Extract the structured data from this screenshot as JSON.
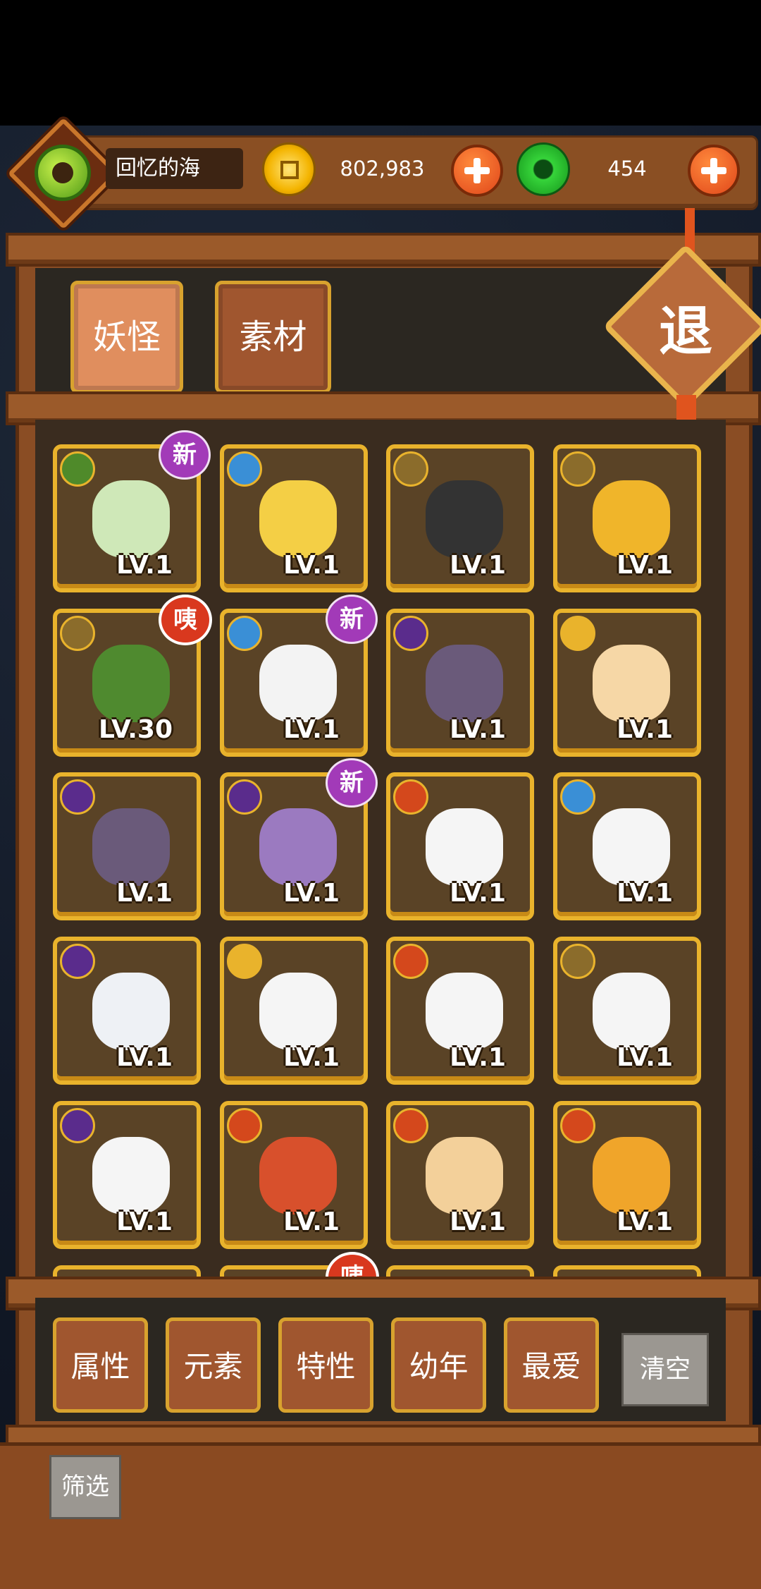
{
  "header": {
    "player_name": "回忆的海",
    "gold": "802,983",
    "jade": "454"
  },
  "tabs": {
    "monsters": "妖怪",
    "materials": "素材"
  },
  "exit_label": "退",
  "cards": [
    {
      "element": "leaf",
      "level": "LV.1",
      "badge": "新",
      "pic_color": "#cfe8b8"
    },
    {
      "element": "water",
      "level": "LV.1",
      "badge": "",
      "pic_color": "#f4cf45"
    },
    {
      "element": "earth",
      "level": "LV.1",
      "badge": "",
      "pic_color": "#333333"
    },
    {
      "element": "earth",
      "level": "LV.1",
      "badge": "",
      "pic_color": "#f0b52a"
    },
    {
      "element": "earth",
      "level": "LV.30",
      "badge": "咦",
      "pic_color": "#4f8a2f"
    },
    {
      "element": "water",
      "level": "LV.1",
      "badge": "新",
      "pic_color": "#f3f3f3"
    },
    {
      "element": "moon",
      "level": "LV.1",
      "badge": "",
      "pic_color": "#6a5a7a"
    },
    {
      "element": "sun",
      "level": "LV.1",
      "badge": "",
      "pic_color": "#f6d7a6"
    },
    {
      "element": "moon",
      "level": "LV.1",
      "badge": "",
      "pic_color": "#6a5a7a"
    },
    {
      "element": "moon",
      "level": "LV.1",
      "badge": "新",
      "pic_color": "#9b7ac0"
    },
    {
      "element": "fire",
      "level": "LV.1",
      "badge": "",
      "pic_color": "#f5f5f5"
    },
    {
      "element": "water",
      "level": "LV.1",
      "badge": "",
      "pic_color": "#f5f5f5"
    },
    {
      "element": "moon",
      "level": "LV.1",
      "badge": "",
      "pic_color": "#eef1f5"
    },
    {
      "element": "sun",
      "level": "LV.1",
      "badge": "",
      "pic_color": "#f5f5f5"
    },
    {
      "element": "fire",
      "level": "LV.1",
      "badge": "",
      "pic_color": "#f5f5f5"
    },
    {
      "element": "earth",
      "level": "LV.1",
      "badge": "",
      "pic_color": "#f5f5f5"
    },
    {
      "element": "moon",
      "level": "LV.1",
      "badge": "",
      "pic_color": "#f5f5f5"
    },
    {
      "element": "fire",
      "level": "LV.1",
      "badge": "",
      "pic_color": "#d8502c"
    },
    {
      "element": "fire",
      "level": "LV.1",
      "badge": "",
      "pic_color": "#f3d09a"
    },
    {
      "element": "fire",
      "level": "LV.1",
      "badge": "",
      "pic_color": "#f0a52a"
    }
  ],
  "partial_badge": "咦",
  "filters": [
    "属性",
    "元素",
    "特性",
    "幼年",
    "最爱"
  ],
  "clear_label": "清空",
  "filter_label": "筛选"
}
